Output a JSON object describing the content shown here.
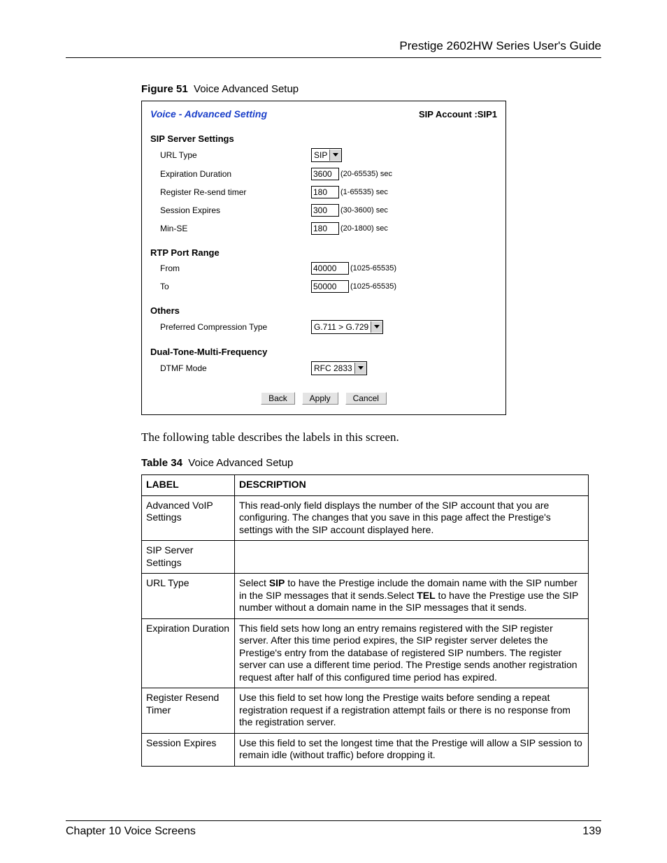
{
  "header": {
    "guideTitle": "Prestige 2602HW Series User's Guide"
  },
  "figure": {
    "label": "Figure 51",
    "title": "Voice Advanced Setup"
  },
  "dialog": {
    "title": "Voice - Advanced Setting",
    "account": "SIP Account :SIP1",
    "sections": {
      "sip": {
        "heading": "SIP Server Settings",
        "urlType": {
          "label": "URL Type",
          "value": "SIP"
        },
        "expDuration": {
          "label": "Expiration Duration",
          "value": "3600",
          "suffix": "(20-65535) sec"
        },
        "registerResend": {
          "label": "Register Re-send timer",
          "value": "180",
          "suffix": "(1-65535) sec"
        },
        "sessionExpires": {
          "label": "Session Expires",
          "value": "300",
          "suffix": "(30-3600) sec"
        },
        "minSE": {
          "label": "Min-SE",
          "value": "180",
          "suffix": "(20-1800) sec"
        }
      },
      "rtp": {
        "heading": "RTP Port Range",
        "from": {
          "label": "From",
          "value": "40000",
          "suffix": "(1025-65535)"
        },
        "to": {
          "label": "To",
          "value": "50000",
          "suffix": "(1025-65535)"
        }
      },
      "others": {
        "heading": "Others",
        "compression": {
          "label": "Preferred Compression Type",
          "value": "G.711 > G.729"
        }
      },
      "dtmf": {
        "heading": "Dual-Tone-Multi-Frequency",
        "mode": {
          "label": "DTMF Mode",
          "value": "RFC 2833"
        }
      }
    },
    "buttons": {
      "back": "Back",
      "apply": "Apply",
      "cancel": "Cancel"
    }
  },
  "bodyPara": "The following table describes the labels in this screen.",
  "table": {
    "label": "Table 34",
    "title": "Voice Advanced Setup",
    "headers": {
      "label": "LABEL",
      "desc": "DESCRIPTION"
    },
    "rows": [
      {
        "label": "Advanced VoIP Settings",
        "desc": "This read-only field displays the number of the SIP account that you are configuring. The changes that you save in this page affect the Prestige's settings with the SIP account displayed here."
      },
      {
        "label": "SIP Server Settings",
        "desc": ""
      },
      {
        "label": "URL Type",
        "descPrefix": "Select ",
        "descBold1": "SIP",
        "descMid": " to have the Prestige include the domain name with the SIP number in the SIP messages that it sends.Select ",
        "descBold2": "TEL",
        "descSuffix": " to have the Prestige use the SIP number without a domain name in the SIP messages that it sends."
      },
      {
        "label": "Expiration Duration",
        "desc": "This field sets how long an entry remains registered with the SIP register server. After this time period expires, the SIP register server deletes the Prestige's entry from the database of registered SIP numbers. The register server can use a different time period. The Prestige sends another registration request after half of this configured time period has expired."
      },
      {
        "label": "Register Resend Timer",
        "desc": "Use this field to set how long the Prestige waits before sending a repeat registration request if a registration attempt fails or there is no response from the registration server."
      },
      {
        "label": "Session Expires",
        "desc": "Use this field to set the longest time that the Prestige will allow a SIP session to remain idle (without traffic) before dropping it."
      }
    ]
  },
  "footer": {
    "chapter": "Chapter 10 Voice Screens",
    "page": "139"
  }
}
